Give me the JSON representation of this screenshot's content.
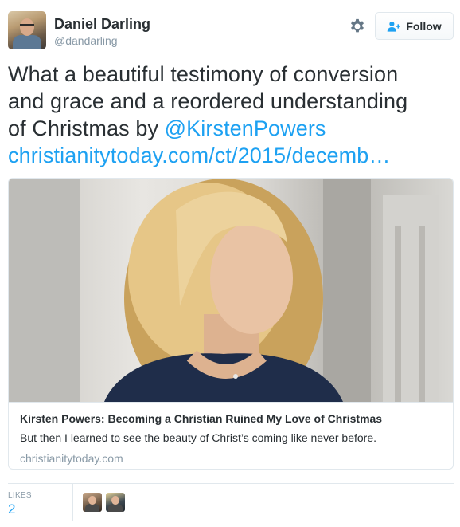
{
  "author": {
    "name": "Daniel Darling",
    "handle": "@dandarling"
  },
  "actions": {
    "follow_label": "Follow"
  },
  "tweet": {
    "line1": "What a beautiful testimony of conversion",
    "line2": "and grace and a reordered understanding",
    "line3_prefix": "of Christmas by ",
    "mention": "@KirstenPowers",
    "link": "christianitytoday.com/ct/2015/decemb…"
  },
  "card": {
    "title": "Kirsten Powers: Becoming a Christian Ruined My Love of Christmas",
    "description": "But then I learned to see the beauty of Christ’s coming like never before.",
    "domain": "christianitytoday.com"
  },
  "stats": {
    "likes_label": "LIKES",
    "likes_count": "2"
  },
  "colors": {
    "link": "#1da1f2",
    "text": "#292f33",
    "muted": "#8899a6",
    "border": "#e1e8ed"
  },
  "icons": {
    "settings": "gear-icon",
    "follow": "add-user-icon"
  }
}
